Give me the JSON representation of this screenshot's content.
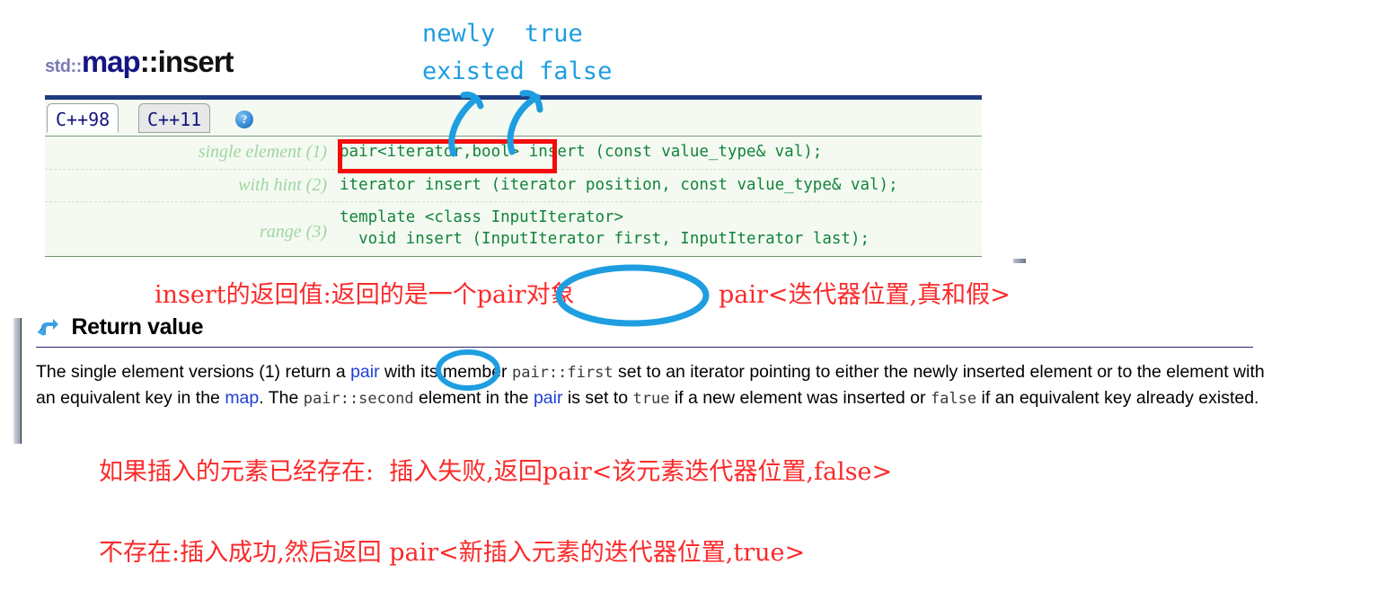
{
  "page": {
    "title_std": "std::",
    "title_map": "map",
    "title_rest": "::insert"
  },
  "tabs": [
    {
      "label": "C++98",
      "active": true
    },
    {
      "label": "C++11",
      "active": false
    }
  ],
  "help_icon_glyph": "?",
  "signatures": [
    {
      "label": "single element (1)",
      "code": "pair<iterator,bool> insert (const value_type& val);"
    },
    {
      "label": "with hint (2)",
      "code": "iterator insert (iterator position, const value_type& val);"
    },
    {
      "label": "range (3)",
      "code": "template <class InputIterator>\n  void insert (InputIterator first, InputIterator last);"
    }
  ],
  "return_value": {
    "heading": "Return value",
    "icon": "return-arrow-icon",
    "text_parts": [
      {
        "t": "The single element versions (1) return a ",
        "style": "plain"
      },
      {
        "t": "pair",
        "style": "link"
      },
      {
        "t": " with its member ",
        "style": "plain"
      },
      {
        "t": "pair::first",
        "style": "mono"
      },
      {
        "t": " set to an iterator pointing to either the newly inserted element or to the element with an equivalent key in the ",
        "style": "plain"
      },
      {
        "t": "map",
        "style": "link"
      },
      {
        "t": ". The ",
        "style": "plain"
      },
      {
        "t": "pair::second",
        "style": "mono"
      },
      {
        "t": " element in the ",
        "style": "plain"
      },
      {
        "t": "pair",
        "style": "link"
      },
      {
        "t": " is set to ",
        "style": "plain"
      },
      {
        "t": "true",
        "style": "mono"
      },
      {
        "t": " if a new element was inserted or ",
        "style": "plain"
      },
      {
        "t": "false",
        "style": "mono"
      },
      {
        "t": " if an equivalent key already existed.",
        "style": "plain"
      }
    ],
    "full_text": "The single element versions (1) return a pair, with its member pair::first set to an iterator pointing to either the newly inserted element or to the element with an equivalent key in the map. The pair::second element in the pair is set to true if a new element was inserted or false if an equivalent key already existed."
  },
  "annotations": {
    "blue_line1": "newly  true",
    "blue_line2": "existed false",
    "red_return_note": "insert的返回值:返回的是一个pair对象",
    "red_pair_generic": "pair<迭代器位置,真和假>",
    "red_exists_case": "如果插入的元素已经存在:  插入失败,返回pair<该元素迭代器位置,false>",
    "red_not_exists_case": "不存在:插入成功,然后返回 pair<新插入元素的迭代器位置,true>"
  },
  "colors": {
    "annotation_blue": "#1e9ee0",
    "annotation_red": "#fa2a2a",
    "title_navy": "#151583",
    "code_green": "#13833d",
    "label_green": "#9fd6a2",
    "link_blue": "#1e3fd4",
    "topbar_navy": "#1f3a80",
    "redbox": "#f50b0b"
  }
}
